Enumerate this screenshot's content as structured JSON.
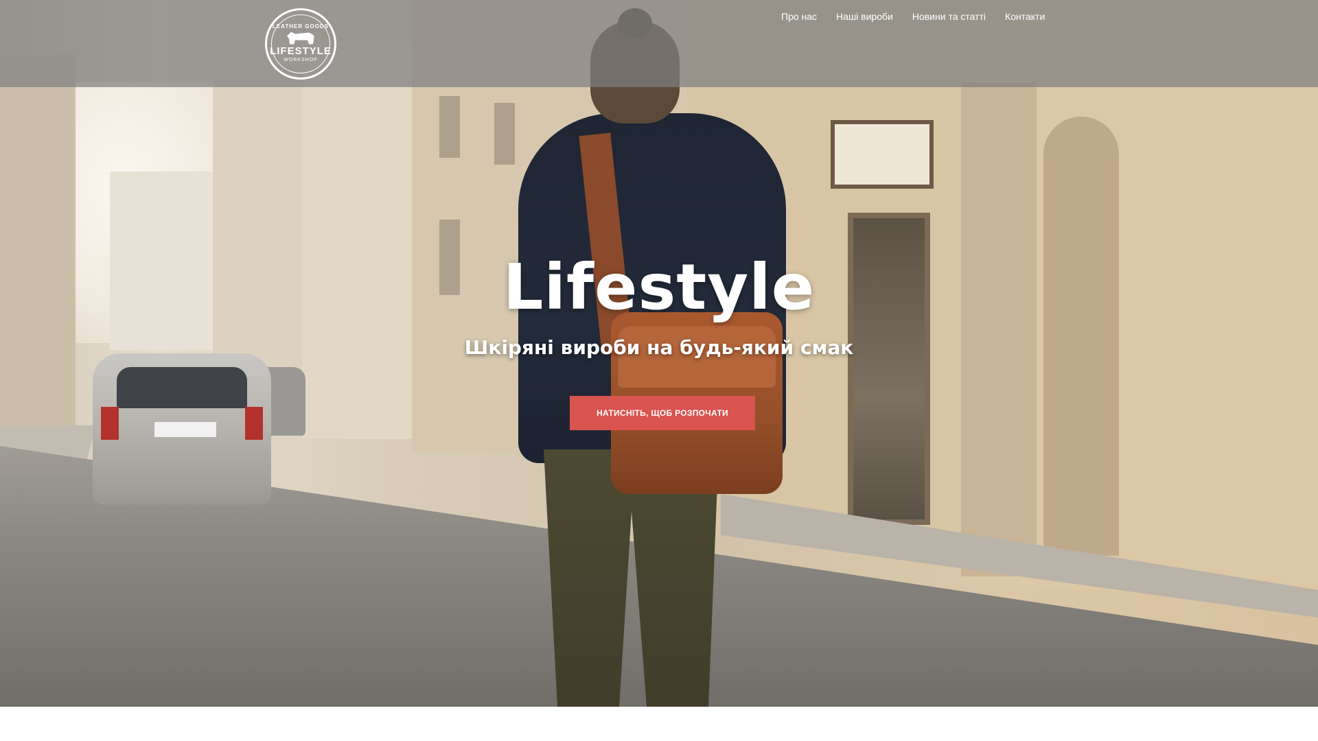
{
  "brand": {
    "logo_top": "LEATHER GOODS",
    "logo_main": "LIFESTYLE",
    "logo_bottom": "WORKSHOP"
  },
  "nav": {
    "items": [
      {
        "label": "Про нас"
      },
      {
        "label": "Наші вироби"
      },
      {
        "label": "Новини та статті"
      },
      {
        "label": "Контакти"
      }
    ]
  },
  "hero": {
    "title": "Lifestyle",
    "subtitle": "Шкіряні вироби на будь-який смак",
    "cta_label": "НАТИСНІТЬ, ЩОБ РОЗПОЧАТИ"
  },
  "colors": {
    "accent": "#d9534f",
    "navbar_bg": "#808080"
  }
}
